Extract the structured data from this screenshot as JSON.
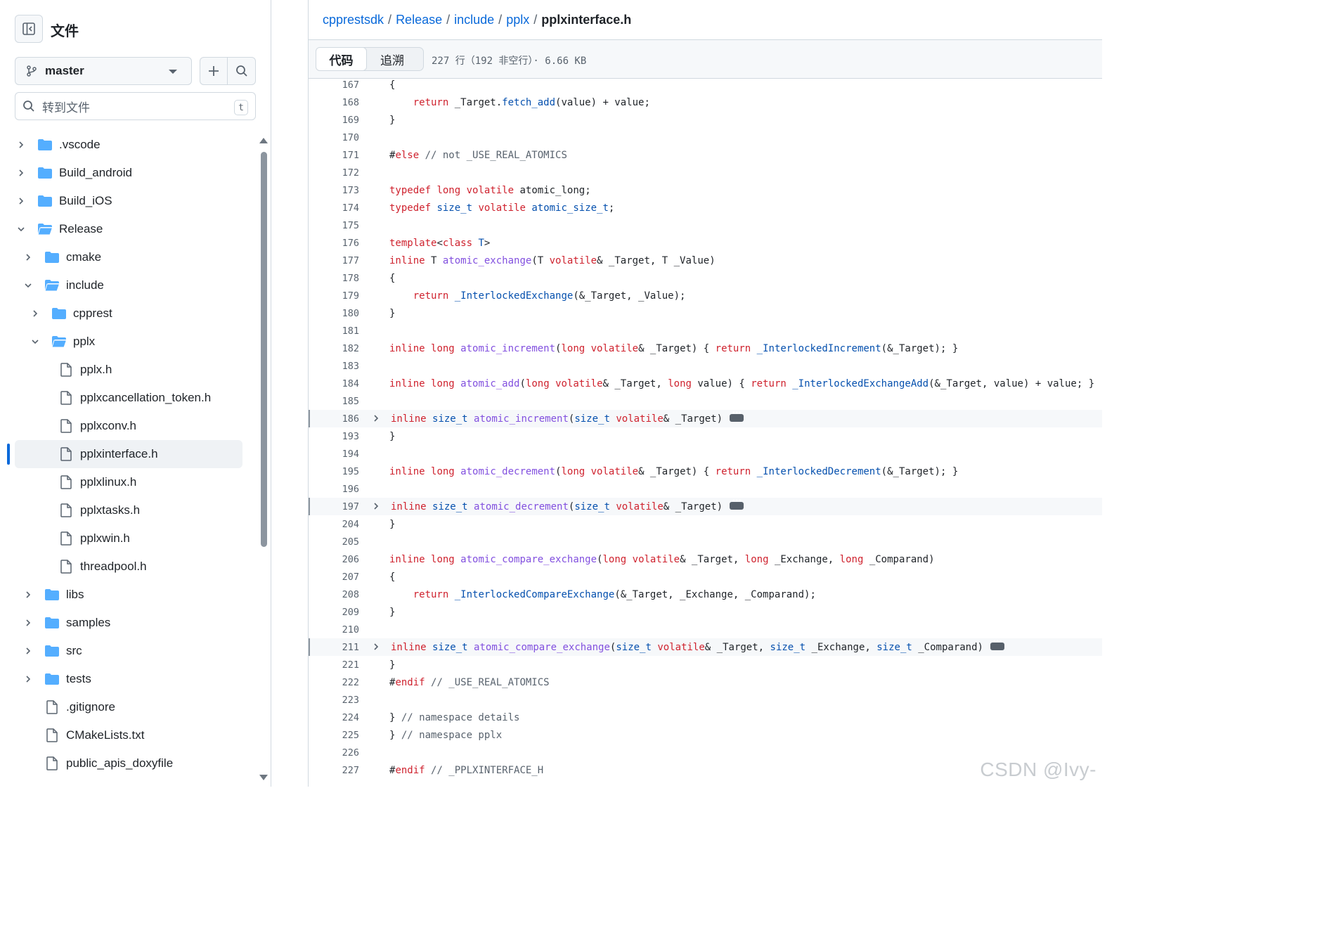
{
  "sidebar": {
    "title": "文件",
    "branch": "master",
    "search_placeholder": "转到文件",
    "search_shortcut": "t",
    "tree": [
      {
        "label": ".vscode",
        "type": "folder",
        "depth": 0,
        "expanded": false
      },
      {
        "label": "Build_android",
        "type": "folder",
        "depth": 0,
        "expanded": false
      },
      {
        "label": "Build_iOS",
        "type": "folder",
        "depth": 0,
        "expanded": false
      },
      {
        "label": "Release",
        "type": "folder",
        "depth": 0,
        "expanded": true
      },
      {
        "label": "cmake",
        "type": "folder",
        "depth": 1,
        "expanded": false
      },
      {
        "label": "include",
        "type": "folder",
        "depth": 1,
        "expanded": true
      },
      {
        "label": "cpprest",
        "type": "folder",
        "depth": 2,
        "expanded": false
      },
      {
        "label": "pplx",
        "type": "folder",
        "depth": 2,
        "expanded": true
      },
      {
        "label": "pplx.h",
        "type": "file",
        "depth": 3
      },
      {
        "label": "pplxcancellation_token.h",
        "type": "file",
        "depth": 3
      },
      {
        "label": "pplxconv.h",
        "type": "file",
        "depth": 3
      },
      {
        "label": "pplxinterface.h",
        "type": "file",
        "depth": 3,
        "active": true
      },
      {
        "label": "pplxlinux.h",
        "type": "file",
        "depth": 3
      },
      {
        "label": "pplxtasks.h",
        "type": "file",
        "depth": 3
      },
      {
        "label": "pplxwin.h",
        "type": "file",
        "depth": 3
      },
      {
        "label": "threadpool.h",
        "type": "file",
        "depth": 3
      },
      {
        "label": "libs",
        "type": "folder",
        "depth": 1,
        "expanded": false
      },
      {
        "label": "samples",
        "type": "folder",
        "depth": 1,
        "expanded": false
      },
      {
        "label": "src",
        "type": "folder",
        "depth": 1,
        "expanded": false
      },
      {
        "label": "tests",
        "type": "folder",
        "depth": 1,
        "expanded": false
      },
      {
        "label": ".gitignore",
        "type": "file",
        "depth": 1
      },
      {
        "label": "CMakeLists.txt",
        "type": "file",
        "depth": 1
      },
      {
        "label": "public_apis_doxyfile",
        "type": "file",
        "depth": 1
      }
    ]
  },
  "breadcrumb": {
    "repo": "cpprestsdk",
    "parts": [
      "Release",
      "include",
      "pplx"
    ],
    "current": "pplxinterface.h"
  },
  "toolbar": {
    "tab_code": "代码",
    "tab_blame": "追溯",
    "file_meta": "227 行（192 非空行）· 6.66 KB"
  },
  "code": [
    {
      "n": "167",
      "tokens": [
        [
          "",
          "{"
        ]
      ]
    },
    {
      "n": "168",
      "tokens": [
        [
          "",
          "    "
        ],
        [
          "k",
          "return"
        ],
        [
          "",
          " _Target."
        ],
        [
          "t",
          "fetch_add"
        ],
        [
          "",
          "(value) + value;"
        ]
      ]
    },
    {
      "n": "169",
      "tokens": [
        [
          "",
          "}"
        ]
      ]
    },
    {
      "n": "170",
      "tokens": []
    },
    {
      "n": "171",
      "tokens": [
        [
          "",
          "#"
        ],
        [
          "k",
          "else"
        ],
        [
          "c",
          " // not _USE_REAL_ATOMICS"
        ]
      ]
    },
    {
      "n": "172",
      "tokens": []
    },
    {
      "n": "173",
      "tokens": [
        [
          "k",
          "typedef"
        ],
        [
          "",
          " "
        ],
        [
          "k",
          "long"
        ],
        [
          "",
          " "
        ],
        [
          "k",
          "volatile"
        ],
        [
          "",
          " atomic_long;"
        ]
      ]
    },
    {
      "n": "174",
      "tokens": [
        [
          "k",
          "typedef"
        ],
        [
          "",
          " "
        ],
        [
          "t",
          "size_t"
        ],
        [
          "",
          " "
        ],
        [
          "k",
          "volatile"
        ],
        [
          "",
          " "
        ],
        [
          "t",
          "atomic_size_t"
        ],
        [
          "",
          ";"
        ]
      ]
    },
    {
      "n": "175",
      "tokens": []
    },
    {
      "n": "176",
      "tokens": [
        [
          "k",
          "template"
        ],
        [
          "",
          "<"
        ],
        [
          "k",
          "class"
        ],
        [
          "",
          " "
        ],
        [
          "t",
          "T"
        ],
        [
          "",
          ">"
        ]
      ]
    },
    {
      "n": "177",
      "tokens": [
        [
          "k",
          "inline"
        ],
        [
          "",
          " T "
        ],
        [
          "f",
          "atomic_exchange"
        ],
        [
          "",
          "(T "
        ],
        [
          "k",
          "volatile"
        ],
        [
          "",
          "& _Target, T _Value)"
        ]
      ]
    },
    {
      "n": "178",
      "tokens": [
        [
          "",
          "{"
        ]
      ]
    },
    {
      "n": "179",
      "tokens": [
        [
          "",
          "    "
        ],
        [
          "k",
          "return"
        ],
        [
          "",
          " "
        ],
        [
          "t",
          "_InterlockedExchange"
        ],
        [
          "",
          "(&_Target, _Value);"
        ]
      ]
    },
    {
      "n": "180",
      "tokens": [
        [
          "",
          "}"
        ]
      ]
    },
    {
      "n": "181",
      "tokens": []
    },
    {
      "n": "182",
      "tokens": [
        [
          "k",
          "inline"
        ],
        [
          "",
          " "
        ],
        [
          "k",
          "long"
        ],
        [
          "",
          " "
        ],
        [
          "f",
          "atomic_increment"
        ],
        [
          "",
          "("
        ],
        [
          "k",
          "long"
        ],
        [
          "",
          " "
        ],
        [
          "k",
          "volatile"
        ],
        [
          "",
          "& _Target) { "
        ],
        [
          "k",
          "return"
        ],
        [
          "",
          " "
        ],
        [
          "t",
          "_InterlockedIncrement"
        ],
        [
          "",
          "(&_Target); }"
        ]
      ]
    },
    {
      "n": "183",
      "tokens": []
    },
    {
      "n": "184",
      "tokens": [
        [
          "k",
          "inline"
        ],
        [
          "",
          " "
        ],
        [
          "k",
          "long"
        ],
        [
          "",
          " "
        ],
        [
          "f",
          "atomic_add"
        ],
        [
          "",
          "("
        ],
        [
          "k",
          "long"
        ],
        [
          "",
          " "
        ],
        [
          "k",
          "volatile"
        ],
        [
          "",
          "& _Target, "
        ],
        [
          "k",
          "long"
        ],
        [
          "",
          " value) { "
        ],
        [
          "k",
          "return"
        ],
        [
          "",
          " "
        ],
        [
          "t",
          "_InterlockedExchangeAdd"
        ],
        [
          "",
          "(&_Target, value) + value; }"
        ]
      ]
    },
    {
      "n": "185",
      "tokens": []
    },
    {
      "n": "186",
      "fold": true,
      "tokens": [
        [
          "k",
          "inline"
        ],
        [
          "",
          " "
        ],
        [
          "t",
          "size_t"
        ],
        [
          "",
          " "
        ],
        [
          "f",
          "atomic_increment"
        ],
        [
          "",
          "("
        ],
        [
          "t",
          "size_t"
        ],
        [
          "",
          " "
        ],
        [
          "k",
          "volatile"
        ],
        [
          "",
          "& _Target)"
        ]
      ]
    },
    {
      "n": "193",
      "tokens": [
        [
          "",
          "}"
        ]
      ]
    },
    {
      "n": "194",
      "tokens": []
    },
    {
      "n": "195",
      "tokens": [
        [
          "k",
          "inline"
        ],
        [
          "",
          " "
        ],
        [
          "k",
          "long"
        ],
        [
          "",
          " "
        ],
        [
          "f",
          "atomic_decrement"
        ],
        [
          "",
          "("
        ],
        [
          "k",
          "long"
        ],
        [
          "",
          " "
        ],
        [
          "k",
          "volatile"
        ],
        [
          "",
          "& _Target) { "
        ],
        [
          "k",
          "return"
        ],
        [
          "",
          " "
        ],
        [
          "t",
          "_InterlockedDecrement"
        ],
        [
          "",
          "(&_Target); }"
        ]
      ]
    },
    {
      "n": "196",
      "tokens": []
    },
    {
      "n": "197",
      "fold": true,
      "tokens": [
        [
          "k",
          "inline"
        ],
        [
          "",
          " "
        ],
        [
          "t",
          "size_t"
        ],
        [
          "",
          " "
        ],
        [
          "f",
          "atomic_decrement"
        ],
        [
          "",
          "("
        ],
        [
          "t",
          "size_t"
        ],
        [
          "",
          " "
        ],
        [
          "k",
          "volatile"
        ],
        [
          "",
          "& _Target)"
        ]
      ]
    },
    {
      "n": "204",
      "tokens": [
        [
          "",
          "}"
        ]
      ]
    },
    {
      "n": "205",
      "tokens": []
    },
    {
      "n": "206",
      "tokens": [
        [
          "k",
          "inline"
        ],
        [
          "",
          " "
        ],
        [
          "k",
          "long"
        ],
        [
          "",
          " "
        ],
        [
          "f",
          "atomic_compare_exchange"
        ],
        [
          "",
          "("
        ],
        [
          "k",
          "long"
        ],
        [
          "",
          " "
        ],
        [
          "k",
          "volatile"
        ],
        [
          "",
          "& _Target, "
        ],
        [
          "k",
          "long"
        ],
        [
          "",
          " _Exchange, "
        ],
        [
          "k",
          "long"
        ],
        [
          "",
          " _Comparand)"
        ]
      ]
    },
    {
      "n": "207",
      "tokens": [
        [
          "",
          "{"
        ]
      ]
    },
    {
      "n": "208",
      "tokens": [
        [
          "",
          "    "
        ],
        [
          "k",
          "return"
        ],
        [
          "",
          " "
        ],
        [
          "t",
          "_InterlockedCompareExchange"
        ],
        [
          "",
          "(&_Target, _Exchange, _Comparand);"
        ]
      ]
    },
    {
      "n": "209",
      "tokens": [
        [
          "",
          "}"
        ]
      ]
    },
    {
      "n": "210",
      "tokens": []
    },
    {
      "n": "211",
      "fold": true,
      "tokens": [
        [
          "k",
          "inline"
        ],
        [
          "",
          " "
        ],
        [
          "t",
          "size_t"
        ],
        [
          "",
          " "
        ],
        [
          "f",
          "atomic_compare_exchange"
        ],
        [
          "",
          "("
        ],
        [
          "t",
          "size_t"
        ],
        [
          "",
          " "
        ],
        [
          "k",
          "volatile"
        ],
        [
          "",
          "& _Target, "
        ],
        [
          "t",
          "size_t"
        ],
        [
          "",
          " _Exchange, "
        ],
        [
          "t",
          "size_t"
        ],
        [
          "",
          " _Comparand)"
        ]
      ]
    },
    {
      "n": "221",
      "tokens": [
        [
          "",
          "}"
        ]
      ]
    },
    {
      "n": "222",
      "tokens": [
        [
          "",
          "#"
        ],
        [
          "k",
          "endif"
        ],
        [
          "c",
          " // _USE_REAL_ATOMICS"
        ]
      ]
    },
    {
      "n": "223",
      "tokens": []
    },
    {
      "n": "224",
      "tokens": [
        [
          "",
          "} "
        ],
        [
          "c",
          "// namespace details"
        ]
      ]
    },
    {
      "n": "225",
      "tokens": [
        [
          "",
          "} "
        ],
        [
          "c",
          "// namespace pplx"
        ]
      ]
    },
    {
      "n": "226",
      "tokens": []
    },
    {
      "n": "227",
      "tokens": [
        [
          "",
          "#"
        ],
        [
          "k",
          "endif"
        ],
        [
          "c",
          " // _PPLXINTERFACE_H"
        ]
      ]
    }
  ],
  "watermark": "CSDN @Ivy-"
}
